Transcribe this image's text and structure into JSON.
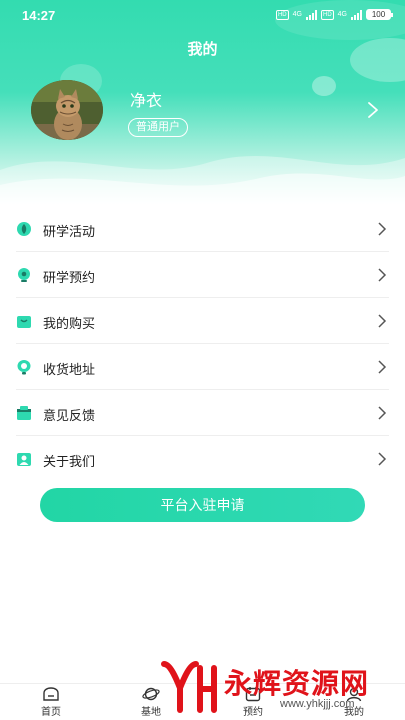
{
  "status_bar": {
    "time": "14:27",
    "network_1": "HD",
    "signal_1": "4G",
    "network_2": "HD",
    "signal_2": "4G",
    "battery": "100"
  },
  "header": {
    "title": "我的"
  },
  "profile": {
    "name": "净衣",
    "role_badge": "普通用户",
    "avatar_icon": "cat-photo-avatar"
  },
  "menu": {
    "items": [
      {
        "label": "研学活动",
        "icon": "leaf-icon"
      },
      {
        "label": "研学预约",
        "icon": "location-pin-icon"
      },
      {
        "label": "我的购买",
        "icon": "shopping-bag-icon"
      },
      {
        "label": "收货地址",
        "icon": "address-pin-icon"
      },
      {
        "label": "意见反馈",
        "icon": "feedback-box-icon"
      },
      {
        "label": "关于我们",
        "icon": "about-contact-icon"
      }
    ]
  },
  "cta": {
    "label": "平台入驻申请"
  },
  "bottom_nav": {
    "tabs": [
      {
        "label": "首页",
        "icon": "home-icon"
      },
      {
        "label": "基地",
        "icon": "planet-icon"
      },
      {
        "label": "预约",
        "icon": "calendar-icon"
      },
      {
        "label": "我的",
        "icon": "profile-icon"
      }
    ]
  },
  "watermark": {
    "text": "永辉资源网",
    "url": "www.yhkjjj.com"
  },
  "colors": {
    "accent": "#2ed9b0",
    "header_top": "#33dcb0",
    "watermark_red": "#e0131a"
  }
}
